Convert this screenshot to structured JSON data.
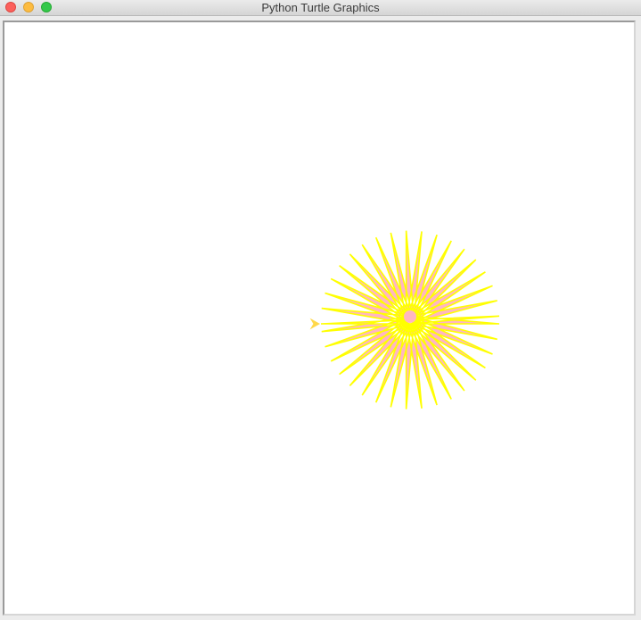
{
  "window": {
    "title": "Python Turtle Graphics"
  },
  "drawing": {
    "pen_color": "#ffff00",
    "fill_color": "#ffb6c1",
    "turtle_color": "#ffd84a",
    "star_points": 36,
    "background": "#ffffff"
  }
}
